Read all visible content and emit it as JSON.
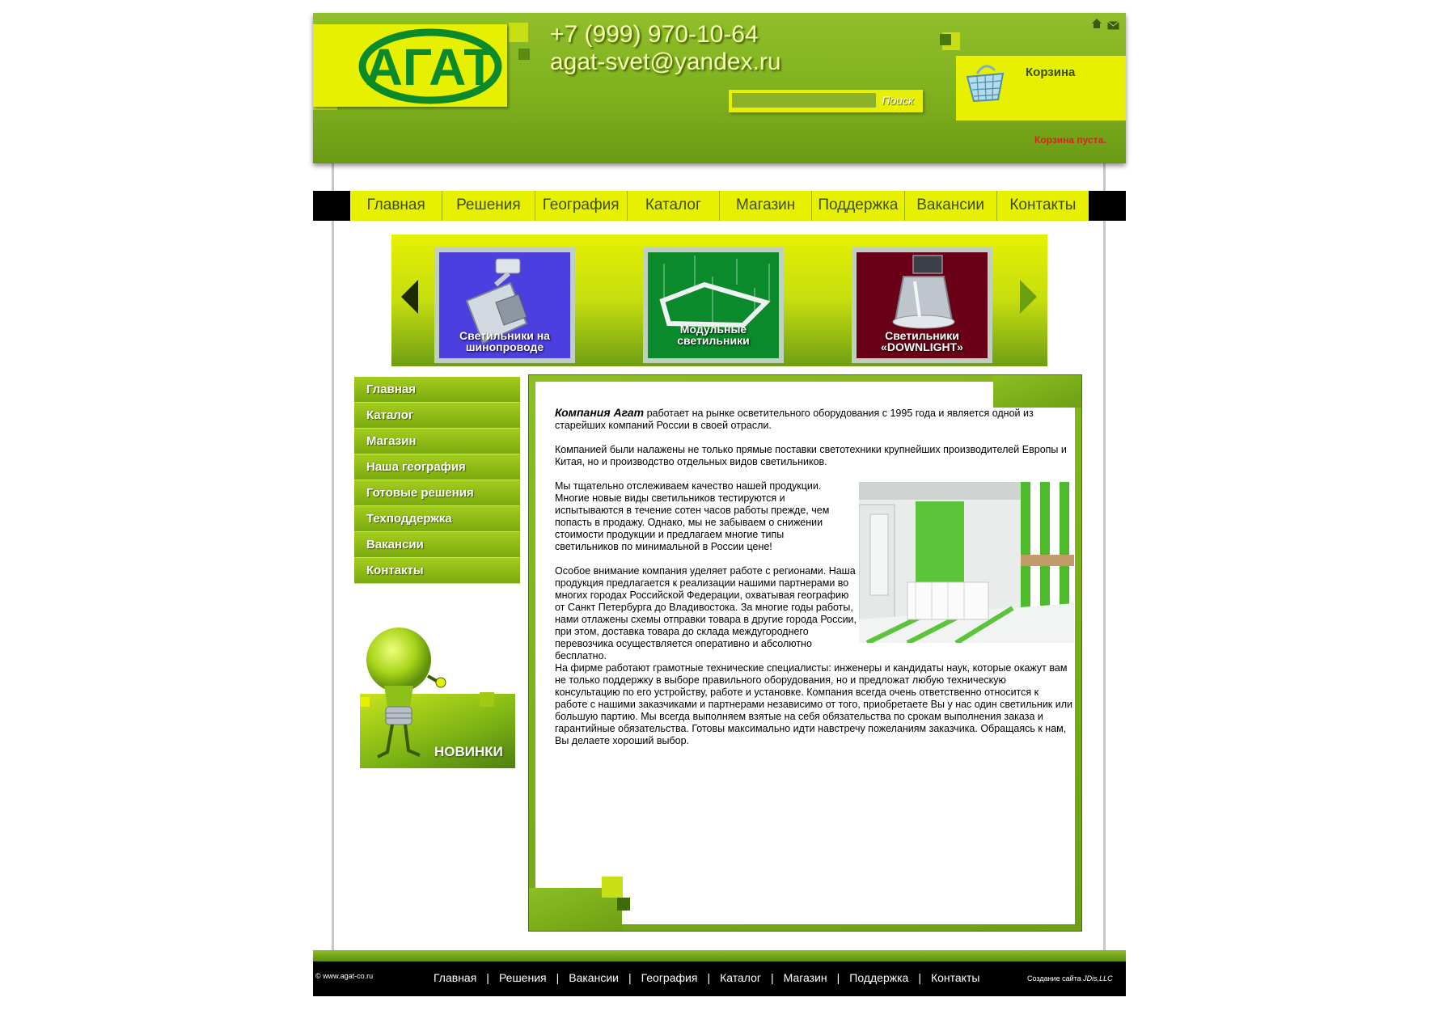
{
  "header": {
    "phone": "+7 (999) 970-10-64",
    "email": "agat-svet@yandex.ru",
    "logo_text": "АГАТ",
    "search": {
      "placeholder": "",
      "button_label": "Поиск"
    },
    "cart": {
      "title": "Корзина",
      "status": "Корзина пуста."
    }
  },
  "top_nav": [
    "Главная",
    "Решения",
    "География",
    "Каталог",
    "Магазин",
    "Поддержка",
    "Вакансии",
    "Контакты"
  ],
  "slider": {
    "slides": [
      {
        "label_line1": "Светильники на",
        "label_line2": "шинопроводе",
        "bg": "#4b3fe0"
      },
      {
        "label_line1": "Модульные",
        "label_line2": "светильники",
        "bg": "#0a8a2a"
      },
      {
        "label_line1": "Светильники",
        "label_line2": "«DOWNLIGHT»",
        "bg": "#6a0018"
      }
    ]
  },
  "side_menu": [
    "Главная",
    "Каталог",
    "Магазин",
    "Наша география",
    "Готовые решения",
    "Техподдержка",
    "Вакансии",
    "Контакты"
  ],
  "promo": {
    "label": "НОВИНКИ"
  },
  "content": {
    "company_name": "Компания Агат",
    "p1_rest": " работает на рынке осветительного оборудования с 1995 года и является одной из старейших компаний России в своей отрасли.",
    "p2": "Компанией были налажены не только прямые поставки  светотехники крупнейших производителей Европы и Китая, но и производство отдельных видов светильников.",
    "p3": "Мы тщательно отслеживаем качество нашей продукции. Многие новые виды светильников тестируются и испытываются в течение сотен часов работы прежде, чем попасть в продажу. Однако, мы не забываем о снижении стоимости продукции и предлагаем многие типы светильников по минимальной в России цене!",
    "p4": "Особое внимание компания уделяет работе с регионами. Наша продукция предлагается к реализации нашими партнерами во многих городах Российской Федерации, охватывая географию от  Санкт Петербурга до Владивостока. За многие годы работы, нами отлажены схемы отправки товара в другие города России, при этом, доставка товара до склада междугороднего перевозчика осуществляется оперативно и абсолютно бесплатно.",
    "p5": "На фирме работают грамотные технические специалисты: инженеры и кандидаты наук, которые окажут вам не только поддержку в выборе правильного оборудования, но и предложат любую техническую консультацию по его устройству, работе и установке. Компания всегда очень ответственно относится к работе с нашими заказчиками и партнерами независимо от того, приобретаете Вы у нас один светильник или большую партию. Мы всегда выполняем взятые на себя обязательства по срокам выполнения заказа и гарантийные обязательства. Готовы максимально идти навстречу пожеланиям заказчика. Обращаясь к нам, Вы делаете хороший выбор."
  },
  "footer": {
    "copyright": "© www.agat-co.ru",
    "nav": [
      "Главная",
      "Решения",
      "Вакансии",
      "География",
      "Каталог",
      "Магазин",
      "Поддержка",
      "Контакты"
    ],
    "credit_prefix": "Создание сайта ",
    "credit_name": "JDis,LLC"
  }
}
